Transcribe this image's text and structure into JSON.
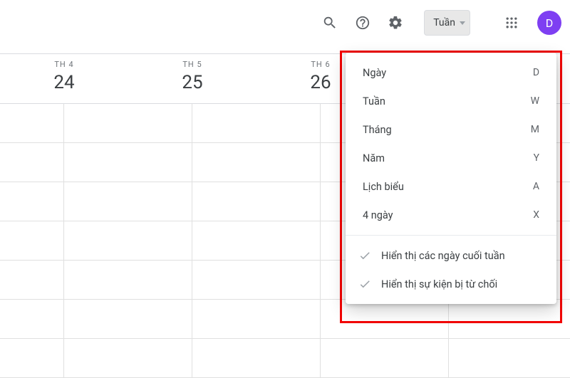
{
  "toolbar": {
    "view_button_label": "Tuần",
    "avatar_initial": "D"
  },
  "calendar": {
    "days": [
      {
        "dow": "TH 4",
        "num": "24"
      },
      {
        "dow": "TH 5",
        "num": "25"
      },
      {
        "dow": "TH 6",
        "num": "26"
      },
      {
        "dow": "",
        "num": ""
      }
    ]
  },
  "view_menu": {
    "items": [
      {
        "label": "Ngày",
        "shortcut": "D"
      },
      {
        "label": "Tuần",
        "shortcut": "W"
      },
      {
        "label": "Tháng",
        "shortcut": "M"
      },
      {
        "label": "Năm",
        "shortcut": "Y"
      },
      {
        "label": "Lịch biểu",
        "shortcut": "A"
      },
      {
        "label": "4 ngày",
        "shortcut": "X"
      }
    ],
    "checks": [
      {
        "label": "Hiển thị các ngày cuối tuần"
      },
      {
        "label": "Hiển thị sự kiện bị từ chối"
      }
    ]
  }
}
